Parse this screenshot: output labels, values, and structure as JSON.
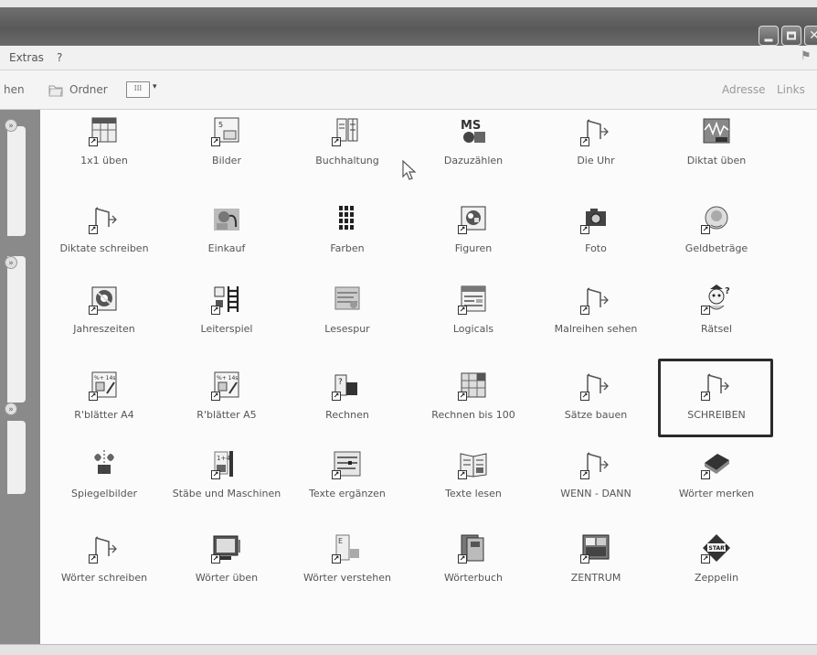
{
  "menu": {
    "extras": "Extras",
    "help": "?"
  },
  "toolbar": {
    "partial": "hen",
    "ordner": "Ordner",
    "adresse": "Adresse",
    "links": "Links"
  },
  "icons": [
    {
      "label": "1x1 üben",
      "icon": "table-icon"
    },
    {
      "label": "Bilder",
      "icon": "picture-cards-icon"
    },
    {
      "label": "Buchhaltung",
      "icon": "ledger-icon"
    },
    {
      "label": "Dazuzählen",
      "icon": "ms-logo-icon"
    },
    {
      "label": "Die Uhr",
      "icon": "blank-document-icon"
    },
    {
      "label": "Diktat üben",
      "icon": "sound-wave-icon"
    },
    {
      "label": "Diktate schreiben",
      "icon": "blank-document-icon"
    },
    {
      "label": "Einkauf",
      "icon": "shopping-icon"
    },
    {
      "label": "Farben",
      "icon": "color-grid-icon"
    },
    {
      "label": "Figuren",
      "icon": "figures-icon"
    },
    {
      "label": "Foto",
      "icon": "camera-icon"
    },
    {
      "label": "Geldbeträge",
      "icon": "money-icon"
    },
    {
      "label": "Jahreszeiten",
      "icon": "seasons-icon"
    },
    {
      "label": "Leiterspiel",
      "icon": "ladder-icon"
    },
    {
      "label": "Lesespur",
      "icon": "reading-trail-icon"
    },
    {
      "label": "Logicals",
      "icon": "logic-grid-icon"
    },
    {
      "label": "Malreihen sehen",
      "icon": "blank-document-icon"
    },
    {
      "label": "Rätsel",
      "icon": "puzzle-figure-icon"
    },
    {
      "label": "R'blätter A4",
      "icon": "worksheet-icon"
    },
    {
      "label": "R'blätter A5",
      "icon": "worksheet-icon"
    },
    {
      "label": "Rechnen",
      "icon": "arithmetic-icon"
    },
    {
      "label": "Rechnen bis 100",
      "icon": "hundred-board-icon"
    },
    {
      "label": "Sätze bauen",
      "icon": "blank-document-icon"
    },
    {
      "label": "SCHREIBEN",
      "icon": "blank-document-icon"
    },
    {
      "label": "Spiegelbilder",
      "icon": "mirror-icon"
    },
    {
      "label": "Stäbe und Maschinen",
      "icon": "rods-icon"
    },
    {
      "label": "Texte ergänzen",
      "icon": "text-fill-icon"
    },
    {
      "label": "Texte lesen",
      "icon": "open-book-icon"
    },
    {
      "label": "WENN - DANN",
      "icon": "blank-document-icon"
    },
    {
      "label": "Wörter merken",
      "icon": "closed-book-icon"
    },
    {
      "label": "Wörter schreiben",
      "icon": "blank-document-icon"
    },
    {
      "label": "Wörter üben",
      "icon": "monitor-icon"
    },
    {
      "label": "Wörter verstehen",
      "icon": "word-list-icon"
    },
    {
      "label": "Wörterbuch",
      "icon": "dictionary-icon"
    },
    {
      "label": "ZENTRUM",
      "icon": "center-board-icon"
    },
    {
      "label": "Zeppelin",
      "icon": "start-sign-icon"
    }
  ],
  "selected": "SCHREIBEN",
  "colors": {
    "titlebar": "#616161",
    "selection": "#2a2a2a"
  }
}
